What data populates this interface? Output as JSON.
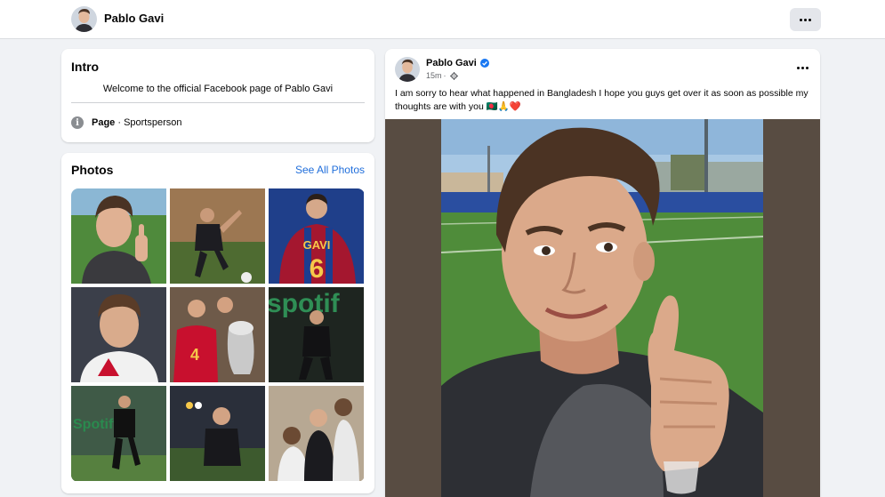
{
  "header": {
    "page_name": "Pablo Gavi",
    "avatar_icon": "profile-avatar",
    "more_icon": "more-dots-icon"
  },
  "intro": {
    "title": "Intro",
    "bio": "Welcome to the official Facebook page of Pablo Gavi",
    "category_label": "Page",
    "category_value": " · Sportsperson",
    "category_icon": "info-icon"
  },
  "photos": {
    "title": "Photos",
    "see_all": "See All Photos",
    "items": [
      {
        "alt": "thumbs-up selfie on pitch"
      },
      {
        "alt": "dribbling ball in training"
      },
      {
        "alt": "GAVI 6 jersey back"
      },
      {
        "alt": "portrait in white jacket"
      },
      {
        "alt": "Spain team with trophy"
      },
      {
        "alt": "training in Spotify kit"
      },
      {
        "alt": "running in training"
      },
      {
        "alt": "celebrating on pitch"
      },
      {
        "alt": "with friends"
      }
    ]
  },
  "post": {
    "author": "Pablo Gavi",
    "time": "15m",
    "privacy_icon": "gear-icon",
    "verified_icon": "verified-badge-icon",
    "text": "I am sorry to hear what happened in Bangladesh I hope you guys get over it as soon as possible my thoughts are with you 🇧🇩🙏❤️",
    "image_alt": "thumbs-up selfie on training pitch"
  },
  "colors": {
    "link": "#216fdb",
    "background": "#f0f2f5",
    "verified": "#1877f2",
    "image_backdrop": "#584c42"
  }
}
